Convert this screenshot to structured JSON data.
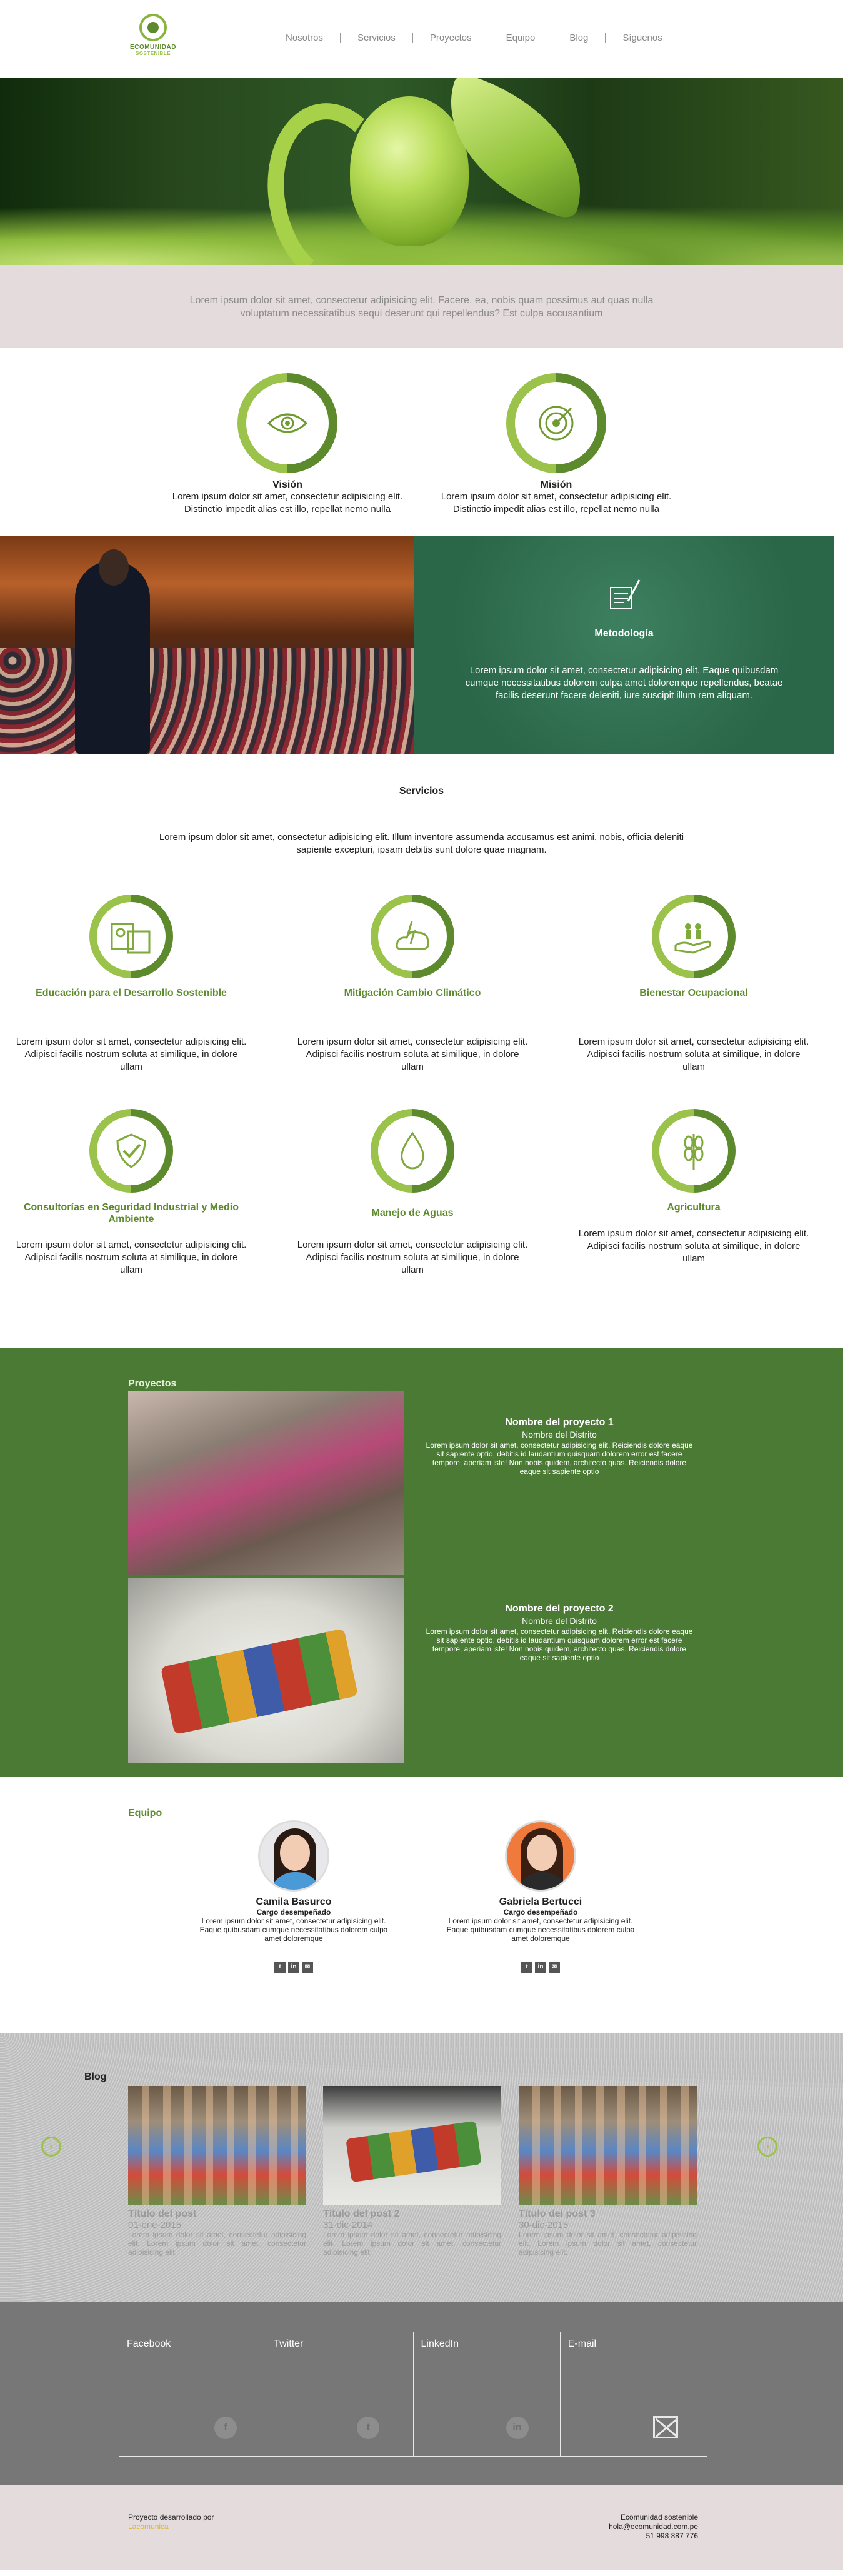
{
  "brand": {
    "line1": "ECOMUNIDAD",
    "line2": "SOSTENIBLE"
  },
  "nav": [
    "Nosotros",
    "Servicios",
    "Proyectos",
    "Equipo",
    "Blog",
    "Síguenos"
  ],
  "intro": "Lorem ipsum dolor sit amet, consectetur adipisicing elit. Facere, ea, nobis quam possimus aut quas nulla voluptatum necessitatibus sequi deserunt qui repellendus? Est culpa accusantium",
  "vision": {
    "title": "Visión",
    "text": "Lorem ipsum dolor sit amet, consectetur adipisicing elit. Distinctio impedit alias est illo, repellat nemo nulla",
    "icon": "eye-icon"
  },
  "mision": {
    "title": "Misión",
    "text": "Lorem ipsum dolor sit amet, consectetur adipisicing elit. Distinctio impedit alias est illo, repellat nemo nulla",
    "icon": "target-icon"
  },
  "metodologia": {
    "title": "Metodología",
    "text": "Lorem ipsum dolor sit amet, consectetur adipisicing elit. Eaque quibusdam cumque necessitatibus dolorem culpa amet doloremque repellendus, beatae facilis deserunt facere deleniti, iure suscipit illum rem aliquam.",
    "icon": "document-pen-icon"
  },
  "servicios": {
    "title": "Servicios",
    "lead": "Lorem ipsum dolor sit amet, consectetur adipisicing elit. Illum inventore assumenda accusamus est animi, nobis, officia deleniti sapiente excepturi, ipsam debitis sunt dolore quae magnam.",
    "items": [
      {
        "title": "Educación para el Desarrollo Sostenible",
        "text": "Lorem ipsum dolor sit amet, consectetur adipisicing elit. Adipisci facilis nostrum soluta at similique, in dolore ullam",
        "icon": "education-icon"
      },
      {
        "title": "Mitigación Cambio Climático",
        "text": "Lorem ipsum dolor sit amet, consectetur adipisicing elit. Adipisci facilis nostrum soluta at similique, in dolore ullam",
        "icon": "climate-icon"
      },
      {
        "title": "Bienestar Ocupacional",
        "text": "Lorem ipsum dolor sit amet, consectetur adipisicing elit. Adipisci facilis nostrum soluta at similique, in dolore ullam",
        "icon": "hand-people-icon"
      },
      {
        "title": "Consultorías en Seguridad Industrial y Medio Ambiente",
        "text": "Lorem ipsum dolor sit amet, consectetur adipisicing elit. Adipisci facilis nostrum soluta at similique, in dolore ullam",
        "icon": "shield-check-icon"
      },
      {
        "title": "Manejo de Aguas",
        "text": "Lorem ipsum dolor sit amet, consectetur adipisicing elit. Adipisci facilis nostrum soluta at similique, in dolore ullam",
        "icon": "water-drop-icon"
      },
      {
        "title": "Agricultura",
        "text": "Lorem ipsum dolor sit amet, consectetur adipisicing elit. Adipisci facilis nostrum soluta at similique, in dolore ullam",
        "icon": "wheat-icon"
      }
    ]
  },
  "proyectos": {
    "title": "Proyectos",
    "items": [
      {
        "name": "Nombre del proyecto 1",
        "district": "Nombre del Distrito",
        "text": "Lorem ipsum dolor sit amet, consectetur adipisicing elit. Reiciendis dolore eaque sit sapiente optio, debitis id laudantium quisquam dolorem error est facere tempore, aperiam iste! Non nobis quidem, architecto quas. Reiciendis dolore eaque sit sapiente optio"
      },
      {
        "name": "Nombre del proyecto 2",
        "district": "Nombre del Distrito",
        "text": "Lorem ipsum dolor sit amet, consectetur adipisicing elit. Reiciendis dolore eaque sit sapiente optio, debitis id laudantium quisquam dolorem error est facere tempore, aperiam iste! Non nobis quidem, architecto quas. Reiciendis dolore eaque sit sapiente optio"
      }
    ]
  },
  "equipo": {
    "title": "Equipo",
    "members": [
      {
        "name": "Camila Basurco",
        "cargo": "Cargo desempeñado",
        "text": "Lorem ipsum dolor sit amet, consectetur adipisicing elit. Eaque quibusdam cumque necessitatibus dolorem culpa amet doloremque"
      },
      {
        "name": "Gabriela Bertucci",
        "cargo": "Cargo desempeñado",
        "text": "Lorem ipsum dolor sit amet, consectetur adipisicing elit. Eaque quibusdam cumque necessitatibus dolorem culpa amet doloremque"
      }
    ],
    "social_icons": [
      "twitter-icon",
      "linkedin-icon",
      "email-icon"
    ]
  },
  "blog": {
    "title": "Blog",
    "posts": [
      {
        "title": "Título del post",
        "date": "01-ene-2015",
        "text": "Lorem ipsum dolor sit amet, consectetur adipisicing elit. Lorem ipsum dolor sit amet, consectetur adipisicing elit."
      },
      {
        "title": "Título del post 2",
        "date": "31-dic-2014",
        "text": "Lorem ipsum dolor sit amet, consectetur adipisicing elit. Lorem ipsum dolor sit amet, consectetur adipisicing elit."
      },
      {
        "title": "Título del post 3",
        "date": "30-dic-2015",
        "text": "Lorem ipsum dolor sit amet, consectetur adipisicing elit. Lorem ipsum dolor sit amet, consectetur adipisicing elit."
      }
    ]
  },
  "social_footer": [
    "Facebook",
    "Twitter",
    "LinkedIn",
    "E-mail"
  ],
  "footer": {
    "credit": "Proyecto desarrollado por",
    "credit_link": "Lacomunica",
    "org": "Ecomunidad sostenible",
    "email": "hola@ecomunidad.com.pe",
    "phone": "51 998 887 776"
  },
  "colors": {
    "green_dark": "#5d8a2c",
    "green_light": "#9bc24a",
    "band": "#e4dcdc",
    "projects_bg": "#4a7a34",
    "board": "#2b6a4b"
  }
}
